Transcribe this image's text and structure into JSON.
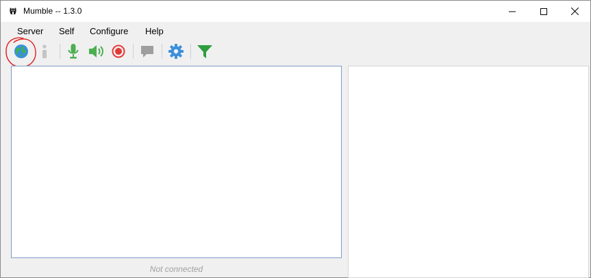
{
  "window": {
    "title": "Mumble -- 1.3.0",
    "app_icon": "mumble-logo-icon",
    "controls": [
      "minimize-icon",
      "maximize-icon",
      "close-icon"
    ]
  },
  "menu": {
    "items": [
      "Server",
      "Self",
      "Configure",
      "Help"
    ]
  },
  "toolbar": {
    "buttons": [
      {
        "icon": "globe-connect-icon",
        "color": "#3c8fdc"
      },
      {
        "icon": "info-icon",
        "color": "#c4c4c4"
      },
      {
        "icon": "microphone-icon",
        "color": "#4caf50"
      },
      {
        "icon": "speaker-icon",
        "color": "#4caf50"
      },
      {
        "icon": "record-icon",
        "color": "#e53935"
      },
      {
        "icon": "comment-icon",
        "color": "#9e9e9e"
      },
      {
        "icon": "settings-gear-icon",
        "color": "#3c8fdc"
      },
      {
        "icon": "filter-icon",
        "color": "#2e9e3e"
      }
    ]
  },
  "annotation": {
    "color": "#e02020",
    "target": "globe-connect-icon"
  },
  "status": {
    "text": "Not connected"
  }
}
